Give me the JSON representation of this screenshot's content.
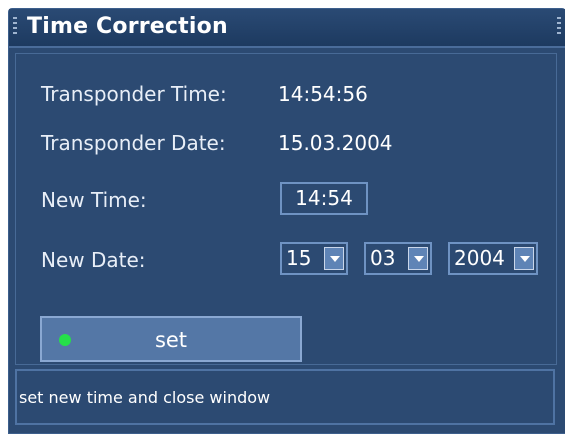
{
  "window": {
    "title": "Time Correction"
  },
  "info": {
    "transponder_time_label": "Transponder Time:",
    "transponder_time_value": "14:54:56",
    "transponder_date_label": "Transponder Date:",
    "transponder_date_value": "15.03.2004"
  },
  "form": {
    "new_time_label": "New Time:",
    "new_time_value": "14:54",
    "new_date_label": "New Date:",
    "day_value": "15",
    "month_value": "03",
    "year_value": "2004"
  },
  "buttons": {
    "set_label": "set",
    "set_indicator_color": "#25e04a"
  },
  "status": {
    "text": "set new time and close window"
  },
  "icons": {
    "title_grips": "grip-lines-icon",
    "dropdown": "chevron-down-icon",
    "set_indicator": "green-dot-icon"
  },
  "colors": {
    "background": "#2c4a72",
    "accent_border": "#6f93c3",
    "button": "#5477a6"
  }
}
